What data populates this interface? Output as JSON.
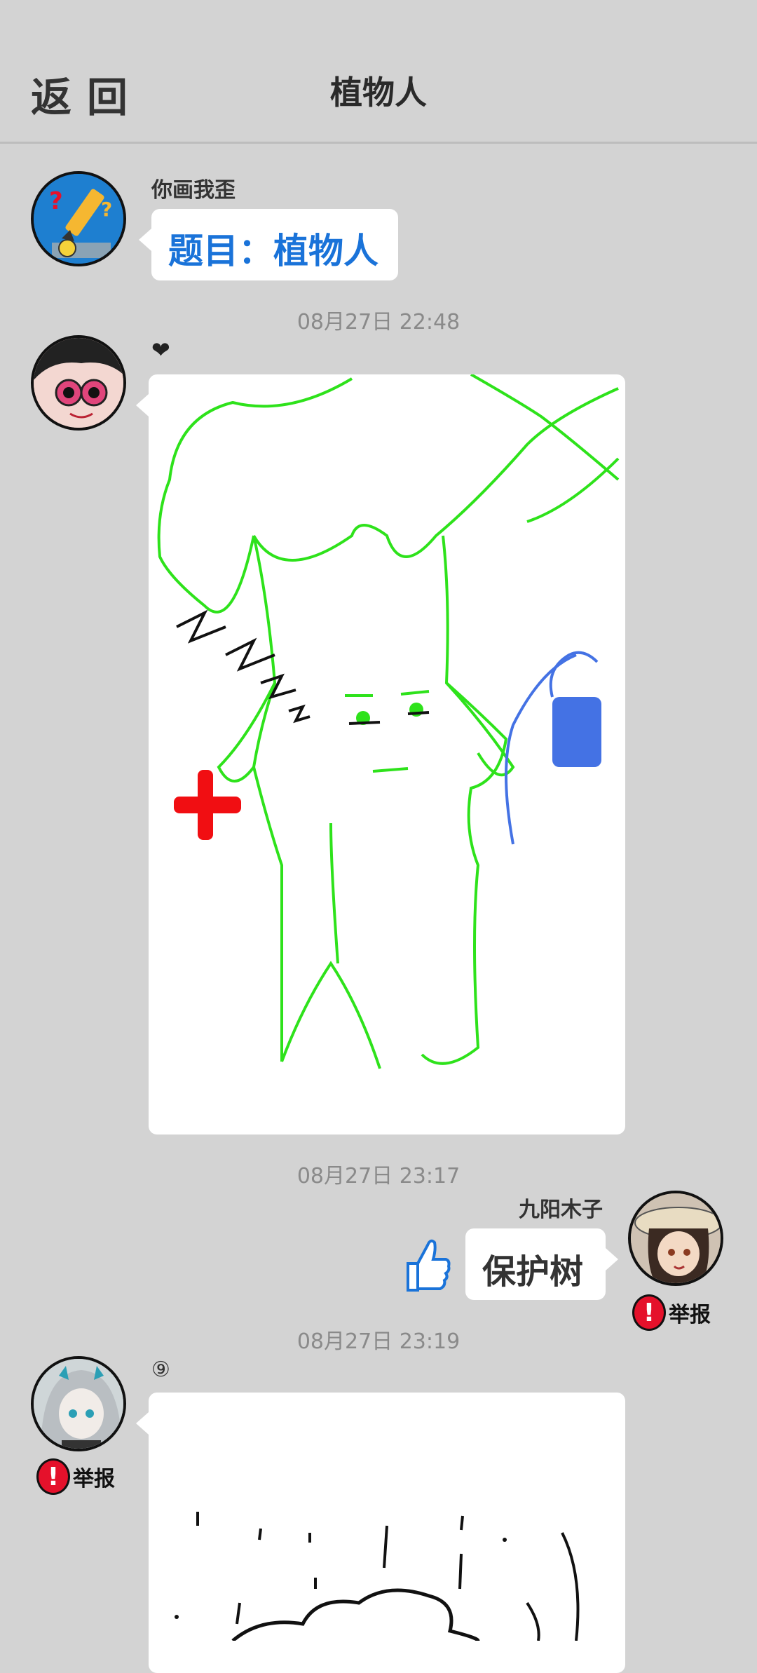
{
  "header": {
    "back_label": "返回",
    "title": "植物人"
  },
  "messages": {
    "m1": {
      "sender": "你画我歪",
      "text": "题目：植物人"
    },
    "t1": "08月27日  22:48",
    "m2": {
      "sender": "❤"
    },
    "t2": "08月27日  23:17",
    "m3": {
      "sender": "九阳木子",
      "text": "保护树",
      "report": "举报"
    },
    "t3": "08月27日  23:19",
    "m4": {
      "sender": "⑨",
      "report": "举报"
    }
  },
  "colors": {
    "accent": "#1a73d9",
    "report": "#e5112b",
    "background": "#d3d3d3"
  }
}
